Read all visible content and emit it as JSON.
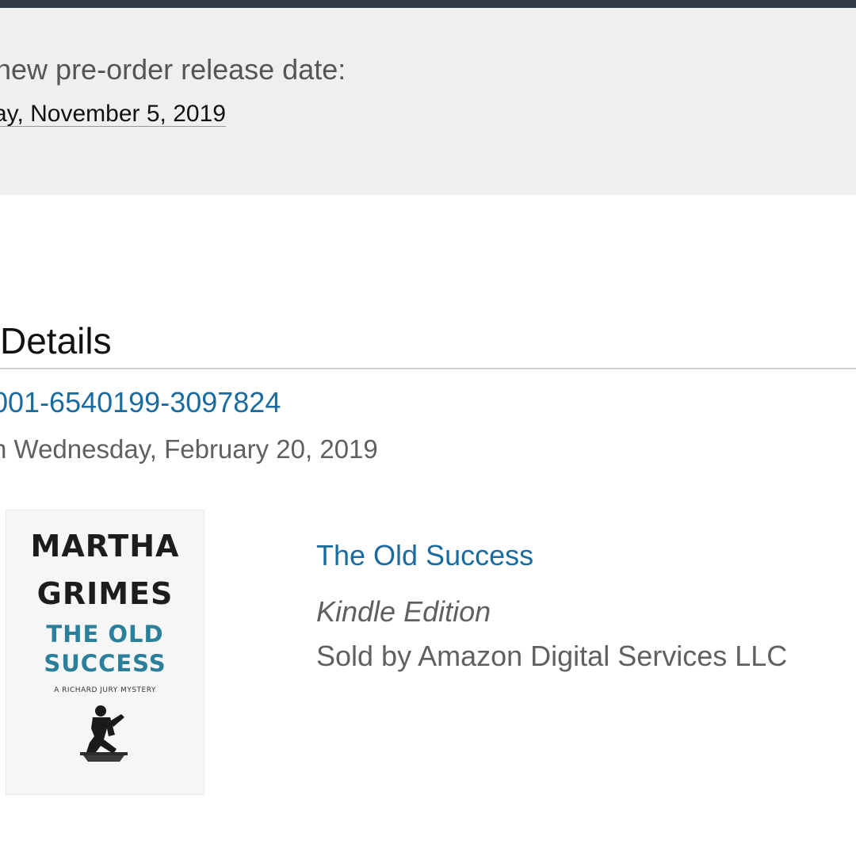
{
  "preorder_notice": {
    "label": "new pre-order release date:",
    "date": "ay, November 5, 2019"
  },
  "details": {
    "heading": "Details",
    "order_number": "001-6540199-3097824",
    "order_date": "n Wednesday, February 20, 2019"
  },
  "item": {
    "cover": {
      "author_first": "MARTHA",
      "author_last": "GRIMES",
      "title_line1": "THE OLD",
      "title_line2": "SUCCESS",
      "series": "A RICHARD JURY MYSTERY"
    },
    "title": "The Old Success",
    "format": "Kindle Edition",
    "seller": "Sold by Amazon Digital Services LLC"
  },
  "colors": {
    "top_bar": "#333a47",
    "notice_background": "#efefef",
    "link": "#1a6ba0",
    "secondary_text": "#606060",
    "cover_title": "#2a7f9a"
  }
}
